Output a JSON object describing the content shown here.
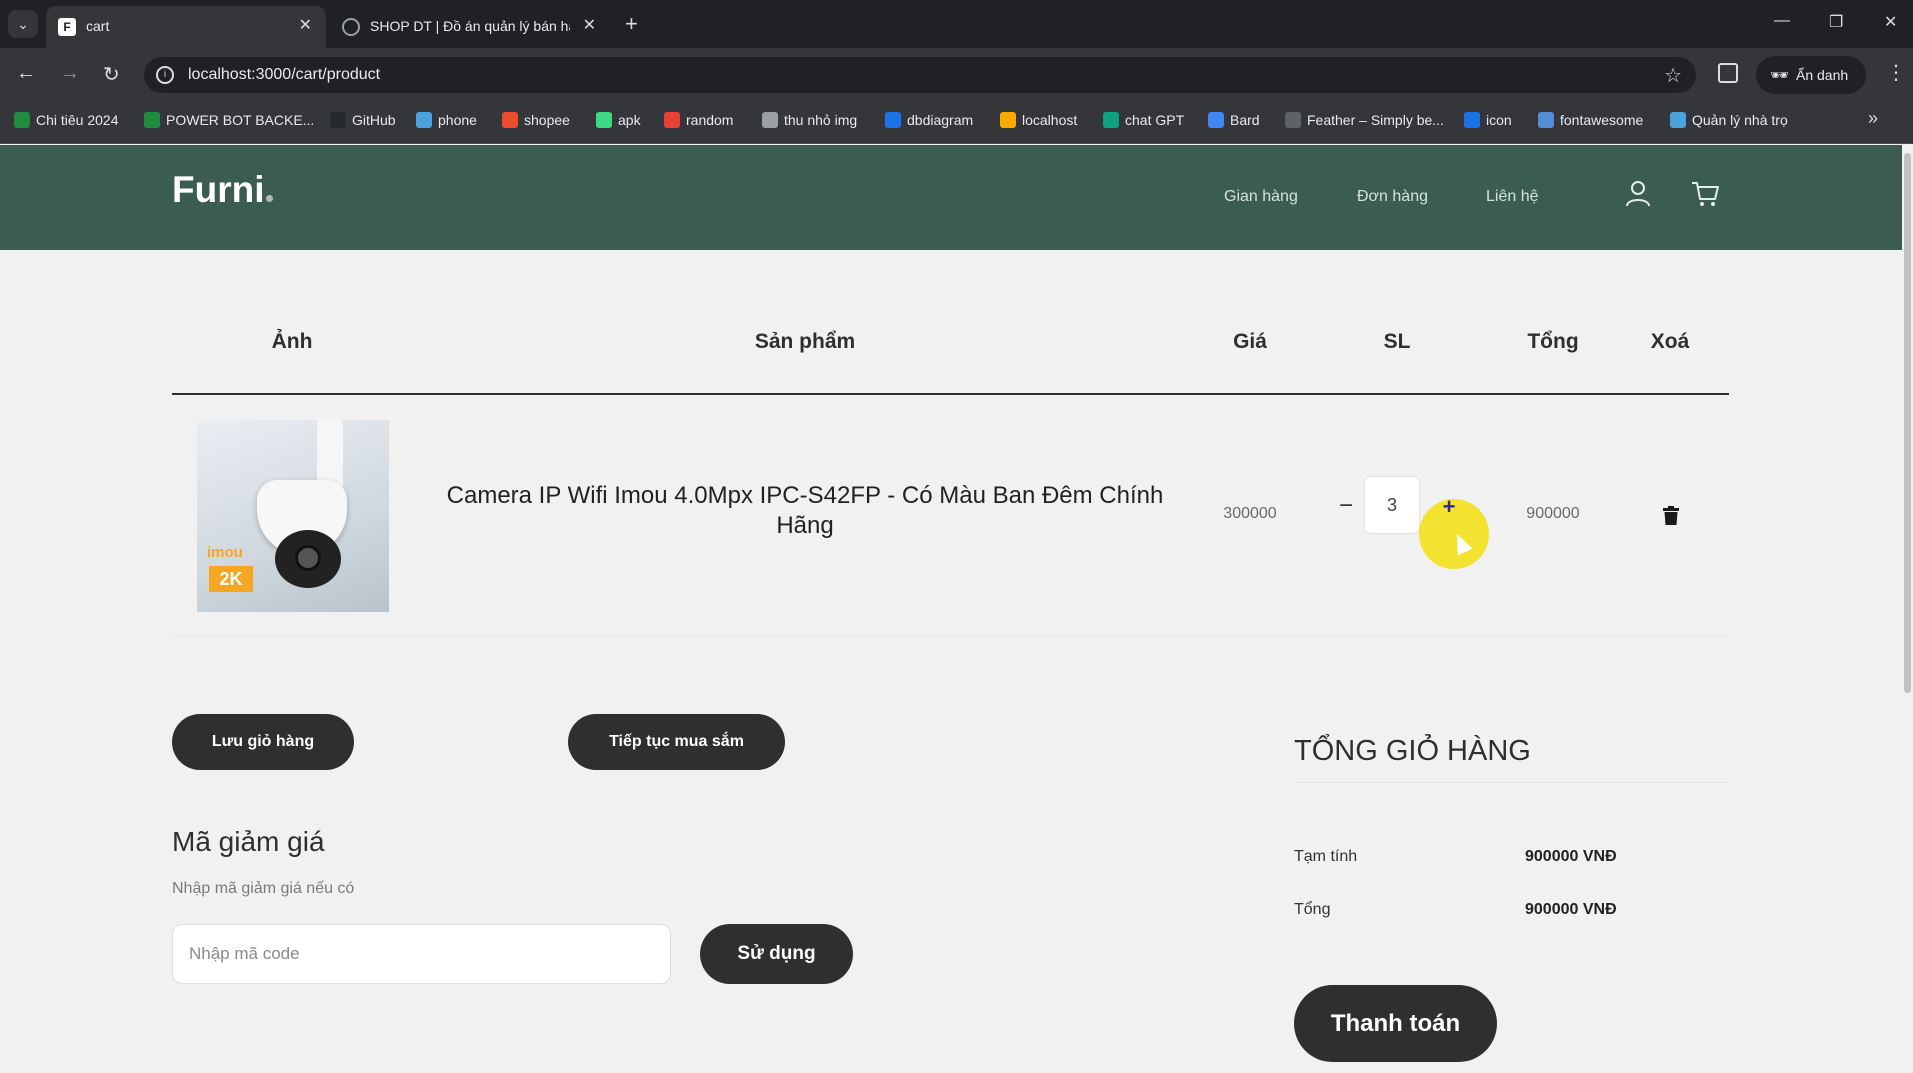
{
  "browser": {
    "tabs": [
      {
        "title": "cart",
        "active": true
      },
      {
        "title": "SHOP DT | Đồ án quản lý bán hàng",
        "active": false
      }
    ],
    "url": "localhost:3000/cart/product",
    "profile_label": "Ẩn danh",
    "bookmarks": [
      {
        "label": "Chi tiêu 2024",
        "color": "#1e8e3e"
      },
      {
        "label": "POWER BOT BACKE...",
        "color": "#1e8e3e"
      },
      {
        "label": "GitHub",
        "color": "#24292e"
      },
      {
        "label": "phone",
        "color": "#4aa3df"
      },
      {
        "label": "shopee",
        "color": "#ee4d2d"
      },
      {
        "label": "apk",
        "color": "#3ddc84"
      },
      {
        "label": "random",
        "color": "#e94235"
      },
      {
        "label": "thu nhỏ img",
        "color": "#9aa0a6"
      },
      {
        "label": "dbdiagram",
        "color": "#1a73e8"
      },
      {
        "label": "localhost",
        "color": "#f9ab00"
      },
      {
        "label": "chat GPT",
        "color": "#10a37f"
      },
      {
        "label": "Bard",
        "color": "#4285f4"
      },
      {
        "label": "Feather – Simply be...",
        "color": "#5f6368"
      },
      {
        "label": "icon",
        "color": "#1a73e8"
      },
      {
        "label": "fontawesome",
        "color": "#538dd7"
      },
      {
        "label": "Quản lý nhà trọ",
        "color": "#4aa3df"
      }
    ]
  },
  "site": {
    "logo": "Furni",
    "nav": [
      "Gian hàng",
      "Đơn hàng",
      "Liên hệ"
    ],
    "header_color": "#3b5d50"
  },
  "cart": {
    "headers": {
      "image": "Ảnh",
      "product": "Sản phẩm",
      "price": "Giá",
      "qty": "SL",
      "total": "Tổng",
      "remove": "Xoá"
    },
    "items": [
      {
        "name": "Camera IP Wifi Imou 4.0Mpx IPC-S42FP - Có Màu Ban Đêm Chính Hãng",
        "image_brand": "imou",
        "image_badge": "2K",
        "price": "300000",
        "qty": "3",
        "total": "900000",
        "minus": "−",
        "plus": "+"
      }
    ],
    "save_button": "Lưu giỏ hàng",
    "continue_button": "Tiếp tục mua sắm"
  },
  "coupon": {
    "title": "Mã giảm giá",
    "subtitle": "Nhập mã giảm giá nếu có",
    "placeholder": "Nhập mã code",
    "apply_button": "Sử dụng"
  },
  "summary": {
    "title": "TỔNG GIỎ HÀNG",
    "subtotal_label": "Tạm tính",
    "subtotal_value": "900000 VNĐ",
    "total_label": "Tổng",
    "total_value": "900000 VNĐ",
    "checkout_button": "Thanh toán"
  }
}
